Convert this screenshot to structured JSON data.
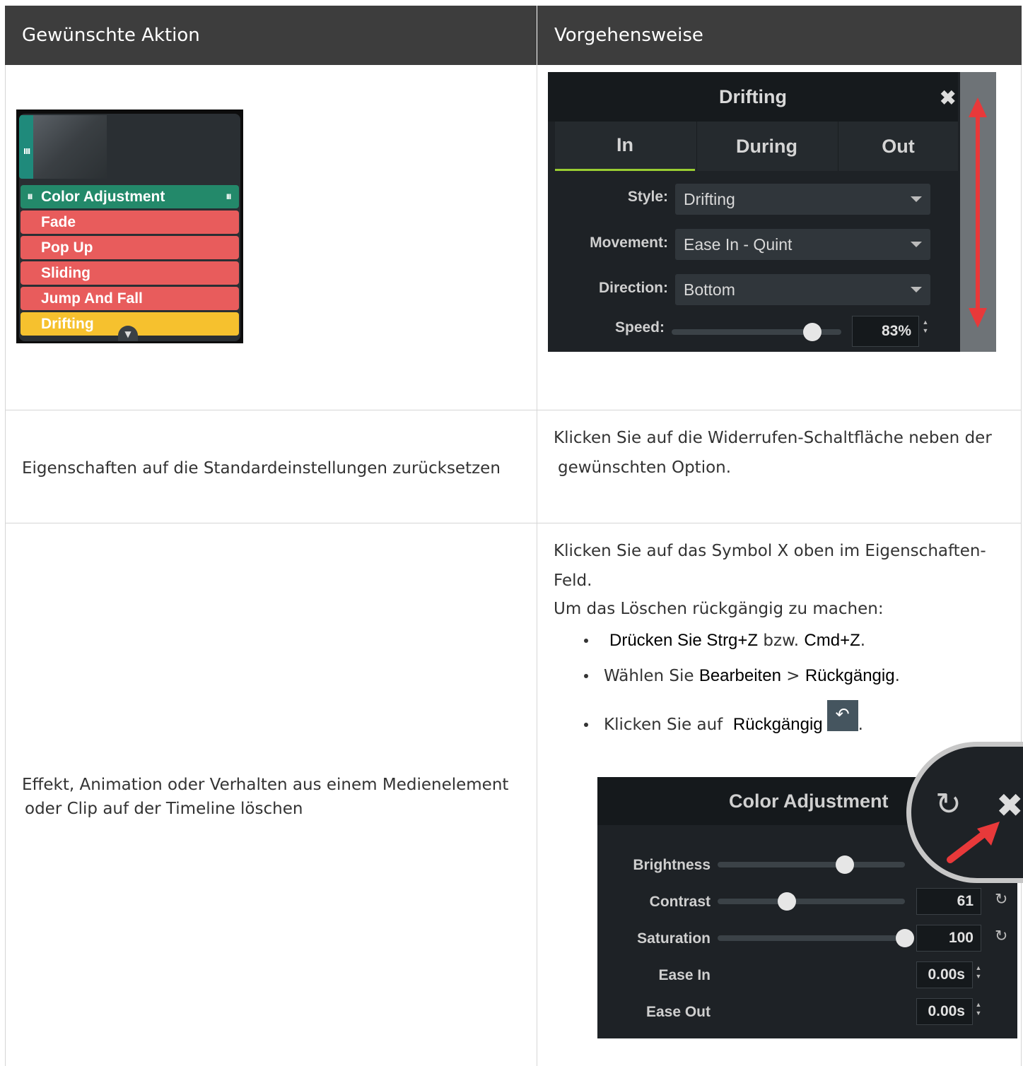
{
  "table": {
    "col1_header": "Gewünschte Aktion",
    "col2_header": "Vorgehensweise"
  },
  "timeline": {
    "color_adjustment": "Color Adjustment",
    "animations": [
      {
        "label": "Fade",
        "color": "#e85c5c"
      },
      {
        "label": "Pop Up",
        "color": "#e85c5c"
      },
      {
        "label": "Sliding",
        "color": "#e85c5c"
      },
      {
        "label": "Jump And Fall",
        "color": "#e85c5c"
      },
      {
        "label": "Drifting",
        "color": "#f6c12e"
      }
    ],
    "effect_color": "#23896a"
  },
  "drifting_panel": {
    "title": "Drifting",
    "tabs": [
      "In",
      "During",
      "Out"
    ],
    "active_tab": "In",
    "style_label": "Style:",
    "style_value": "Drifting",
    "movement_label": "Movement:",
    "movement_value": "Ease In - Quint",
    "direction_label": "Direction:",
    "direction_value": "Bottom",
    "speed_label": "Speed:",
    "speed_value": "83%",
    "speed_fraction": 0.83
  },
  "row2": {
    "action": "Eigenschaften auf die Standardeinstellungen zurücksetzen",
    "procedure_line1": "Klicken Sie auf die Widerrufen-Schaltfläche neben der",
    "procedure_line2": "gewünschten Option."
  },
  "row3": {
    "action_line1": "Effekt, Animation oder Verhalten aus einem Medienelement",
    "action_line2": "oder Clip auf der Timeline löschen",
    "procedure_line1": "Klicken Sie auf das Symbol X oben im Eigenschaften-",
    "procedure_line2": "Feld.",
    "undo_intro": "Um das Löschen rückgängig zu machen:",
    "b1_bold": "Drücken Sie Strg+Z",
    "b1_mid": "bzw.",
    "b1_bold2": "Cmd+Z",
    "b1_end": ".",
    "b2_pre": "Wählen Sie",
    "b2_bold": "Bearbeiten",
    "b2_mid": ">",
    "b2_bold2": "Rückgängig",
    "b2_end": ".",
    "b3_pre": "Klicken Sie auf",
    "b3_bold": "Rückgängig",
    "b3_end": "."
  },
  "color_adjustment_panel": {
    "title": "Color Adjustment",
    "brightness_label": "Brightness",
    "brightness_fraction": 0.68,
    "contrast_label": "Contrast",
    "contrast_value": "61",
    "contrast_fraction": 0.37,
    "saturation_label": "Saturation",
    "saturation_value": "100",
    "saturation_fraction": 1.0,
    "ease_in_label": "Ease In",
    "ease_in_value": "0.00s",
    "ease_out_label": "Ease Out",
    "ease_out_value": "0.00s"
  }
}
